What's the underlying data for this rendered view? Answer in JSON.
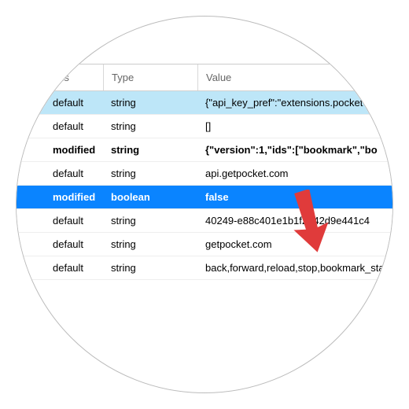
{
  "headers": {
    "status": "Status",
    "type": "Type",
    "value": "Value"
  },
  "rows": [
    {
      "status": "default",
      "type": "string",
      "value": "{\"api_key_pref\":\"extensions.pocket",
      "highlight": "light",
      "bold": false,
      "selected": false
    },
    {
      "status": "default",
      "type": "string",
      "value": "[]",
      "highlight": "none",
      "bold": false,
      "selected": false
    },
    {
      "status": "modified",
      "type": "string",
      "value": "{\"version\":1,\"ids\":[\"bookmark\",\"bo",
      "highlight": "none",
      "bold": true,
      "selected": false
    },
    {
      "status": "default",
      "type": "string",
      "value": "api.getpocket.com",
      "highlight": "none",
      "bold": false,
      "selected": false
    },
    {
      "status": "modified",
      "type": "boolean",
      "value": "false",
      "highlight": "none",
      "bold": true,
      "selected": true
    },
    {
      "status": "default",
      "type": "string",
      "value": "40249-e88c401e1b1f2242d9e441c4",
      "highlight": "none",
      "bold": false,
      "selected": false
    },
    {
      "status": "default",
      "type": "string",
      "value": "getpocket.com",
      "highlight": "none",
      "bold": false,
      "selected": false
    },
    {
      "status": "default",
      "type": "string",
      "value": "back,forward,reload,stop,bookmark_star",
      "highlight": "none",
      "bold": false,
      "selected": false
    }
  ]
}
